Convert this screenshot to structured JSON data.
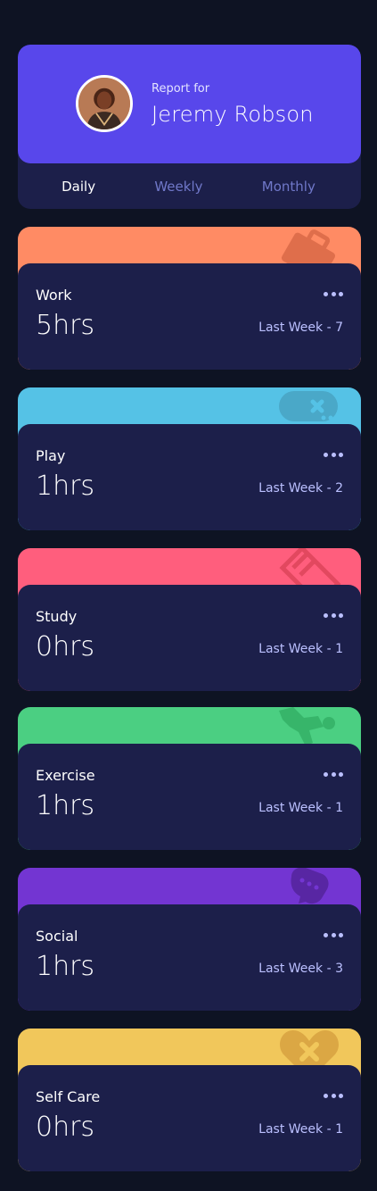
{
  "colors": {
    "background": "#0e1323",
    "card": "#1c1f4a",
    "accent": "#5847eb",
    "muted_text": "#7078c9",
    "pale_text": "#bbc0ff"
  },
  "profile": {
    "report_for": "Report for",
    "name": "Jeremy Robson",
    "avatar_icon": "user-avatar"
  },
  "tabs": [
    {
      "label": "Daily",
      "active": true
    },
    {
      "label": "Weekly",
      "active": false
    },
    {
      "label": "Monthly",
      "active": false
    }
  ],
  "activities": [
    {
      "title": "Work",
      "current": "5hrs",
      "previous": "Last Week - 7",
      "color": "#ff8b64",
      "icon": "briefcase-icon"
    },
    {
      "title": "Play",
      "current": "1hrs",
      "previous": "Last Week - 2",
      "color": "#55c2e6",
      "icon": "gamepad-icon"
    },
    {
      "title": "Study",
      "current": "0hrs",
      "previous": "Last Week - 1",
      "color": "#ff5e7d",
      "icon": "books-icon"
    },
    {
      "title": "Exercise",
      "current": "1hrs",
      "previous": "Last Week - 1",
      "color": "#4bcf82",
      "icon": "running-icon"
    },
    {
      "title": "Social",
      "current": "1hrs",
      "previous": "Last Week - 3",
      "color": "#7335d2",
      "icon": "chat-bubble-icon"
    },
    {
      "title": "Self Care",
      "current": "0hrs",
      "previous": "Last Week - 1",
      "color": "#f1c75b",
      "icon": "heart-icon"
    }
  ]
}
